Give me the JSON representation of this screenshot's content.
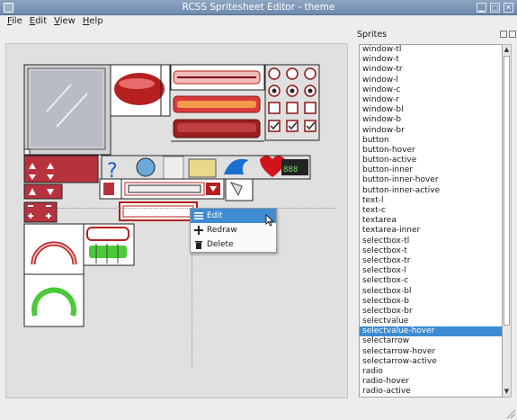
{
  "window": {
    "title": "RCSS Spritesheet Editor - theme"
  },
  "menubar": {
    "items": [
      {
        "accel": "F",
        "rest": "ile"
      },
      {
        "accel": "E",
        "rest": "dit"
      },
      {
        "accel": "V",
        "rest": "iew"
      },
      {
        "accel": "H",
        "rest": "elp"
      }
    ]
  },
  "context_menu": {
    "items": [
      {
        "label": "Edit",
        "icon": "list-icon"
      },
      {
        "label": "Redraw",
        "icon": "plus-icon"
      },
      {
        "label": "Delete",
        "icon": "trash-icon"
      }
    ]
  },
  "sprites_dock": {
    "title": "Sprites",
    "items": [
      "window-tl",
      "window-t",
      "window-tr",
      "window-l",
      "window-c",
      "window-r",
      "window-bl",
      "window-b",
      "window-br",
      "button",
      "button-hover",
      "button-active",
      "button-inner",
      "button-inner-hover",
      "button-inner-active",
      "text-l",
      "text-c",
      "textarea",
      "textarea-inner",
      "selectbox-tl",
      "selectbox-t",
      "selectbox-tr",
      "selectbox-l",
      "selectbox-c",
      "selectbox-bl",
      "selectbox-b",
      "selectbox-br",
      "selectvalue",
      "selectvalue-hover",
      "selectarrow",
      "selectarrow-hover",
      "selectarrow-active",
      "radio",
      "radio-hover",
      "radio-active"
    ],
    "selected": "selectvalue-hover"
  },
  "colors": {
    "selection": "#3d8bd1",
    "theme_red": "#c02a2a",
    "progress_green": "#4cc93a"
  }
}
